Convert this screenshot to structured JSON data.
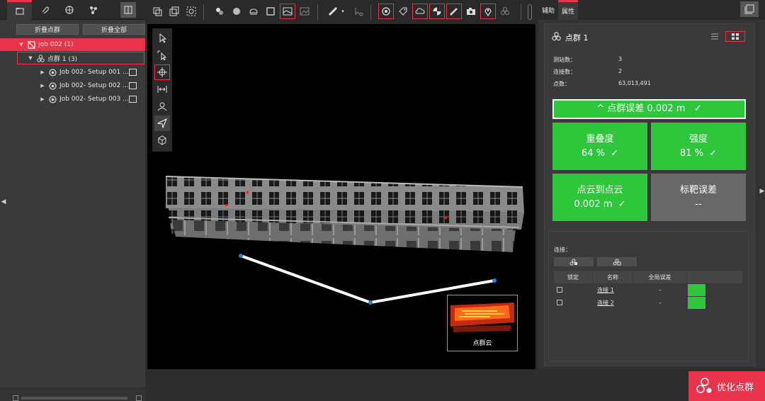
{
  "left": {
    "tabs": [
      "folder-tab",
      "paperclip-tab",
      "globe-tab",
      "network-tab"
    ],
    "buttons": {
      "collapse_group": "折叠点群",
      "collapse_all": "折叠全部"
    },
    "tree": [
      {
        "label": "Job 002 (1)",
        "level": 0,
        "icon": "job-icon"
      },
      {
        "label": "点群 1 (3)",
        "level": 1,
        "icon": "cluster-icon"
      },
      {
        "label": "Job 002- Setup 001 ...",
        "level": 2,
        "icon": "setup-icon"
      },
      {
        "label": "Job 002- Setup 002 ...",
        "level": 2,
        "icon": "setup-icon"
      },
      {
        "label": "Job 002- Setup 003 ...",
        "level": 2,
        "icon": "setup-icon"
      }
    ]
  },
  "viewport": {
    "thumbnail_label": "点群云"
  },
  "right": {
    "tabs": {
      "assist": "辅助",
      "properties": "属性"
    },
    "title": "点群 1",
    "stats": [
      {
        "label": "测站数：",
        "value": "3"
      },
      {
        "label": "连接数：",
        "value": "2"
      },
      {
        "label": "点数：",
        "value": "63,013,491"
      }
    ],
    "error_banner": "^ 点群误差 0.002 m   ✓",
    "metrics": [
      {
        "label": "重叠度",
        "value": "64 %  ✓"
      },
      {
        "label": "强度",
        "value": "81 %  ✓"
      },
      {
        "label": "点云到点云",
        "value": "0.002 m  ✓"
      },
      {
        "label": "标靶误差",
        "value": "--"
      }
    ],
    "connections": {
      "title": "连接：",
      "headers": [
        "锁定",
        "名称",
        "全局误差"
      ],
      "rows": [
        {
          "name": "连接 1",
          "error": "-"
        },
        {
          "name": "连接 2",
          "error": "-"
        }
      ]
    },
    "optimize_label": "优化点群"
  },
  "colors": {
    "accent": "#e8334a",
    "success": "#2ec73c",
    "neutral": "#686868"
  }
}
